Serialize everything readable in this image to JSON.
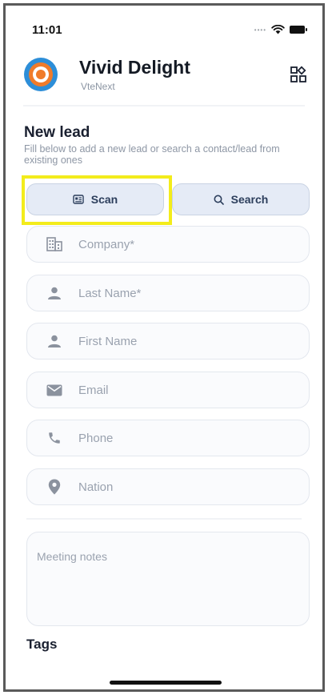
{
  "status_bar": {
    "time": "11:01"
  },
  "header": {
    "app_name": "Vivid Delight",
    "subtitle": "VteNext"
  },
  "form": {
    "title": "New lead",
    "description": "Fill below to add a new lead or search a contact/lead from existing ones",
    "scan_label": "Scan",
    "search_label": "Search",
    "fields": {
      "company": "Company*",
      "last_name": "Last Name*",
      "first_name": "First Name",
      "email": "Email",
      "phone": "Phone",
      "nation": "Nation"
    },
    "notes_placeholder": "Meeting notes",
    "tags_label": "Tags"
  },
  "colors": {
    "highlight": "#f3ec1b",
    "logo_orange": "#f07b2a",
    "logo_blue": "#2d8ed8",
    "button_bg": "#e5ebf6"
  },
  "icons": [
    "wifi-icon",
    "battery-icon",
    "logo-icon",
    "grid-menu-icon",
    "scan-card-icon",
    "search-icon",
    "building-icon",
    "person-icon",
    "mail-icon",
    "phone-icon",
    "location-pin-icon"
  ]
}
